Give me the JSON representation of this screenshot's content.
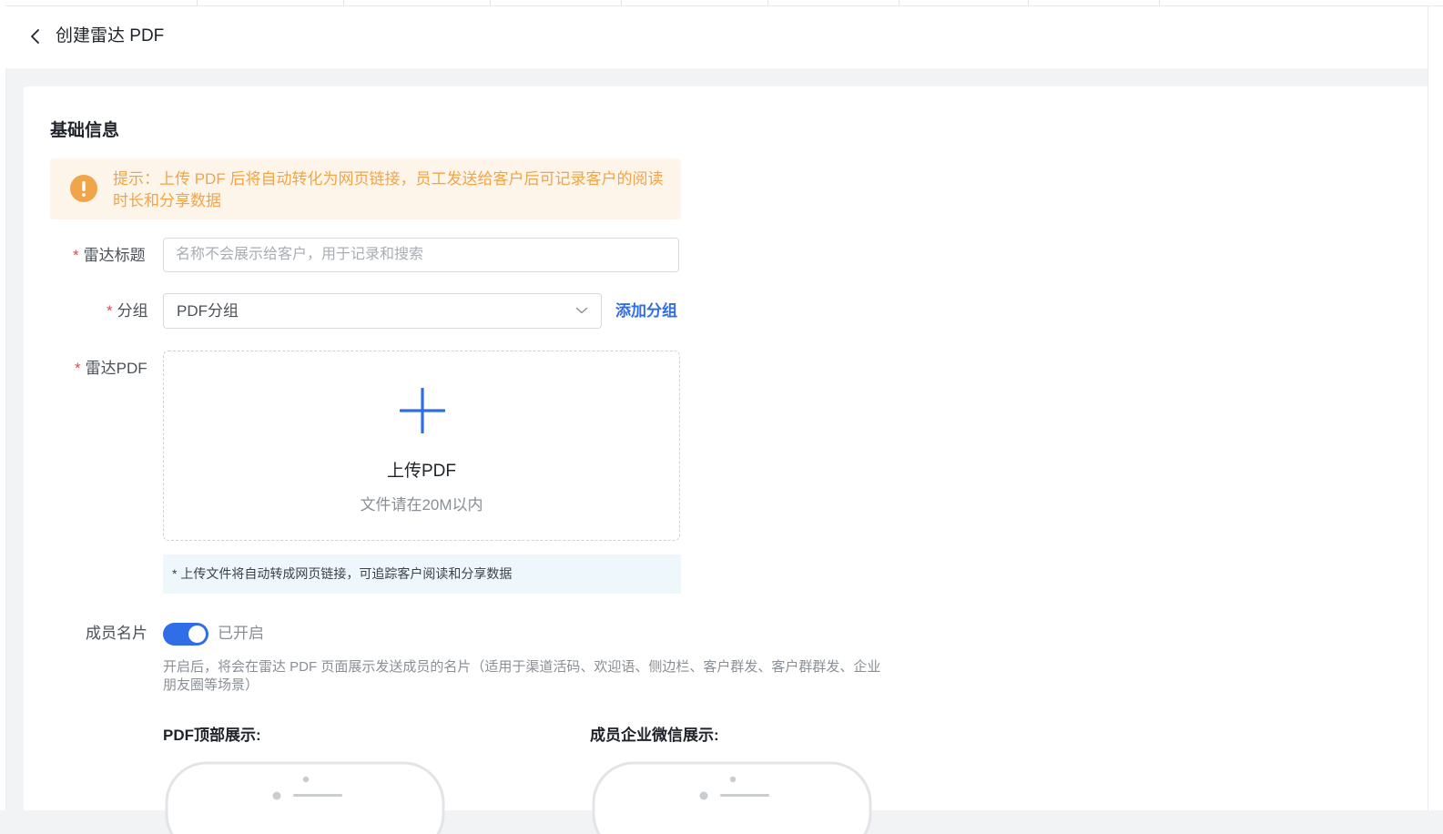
{
  "header": {
    "title": "创建雷达 PDF"
  },
  "section": {
    "title": "基础信息"
  },
  "alert": {
    "text": "提示：上传 PDF 后将自动转化为网页链接，员工发送给客户后可记录客户的阅读时长和分享数据"
  },
  "form": {
    "radar_title": {
      "required": "*",
      "label": "雷达标题",
      "placeholder": "名称不会展示给客户，用于记录和搜索",
      "value": ""
    },
    "group": {
      "required": "*",
      "label": "分组",
      "value": "PDF分组",
      "add_label": "添加分组"
    },
    "radar_pdf": {
      "required": "*",
      "label": "雷达PDF",
      "upload_label": "上传PDF",
      "upload_hint": "文件请在20M以内",
      "note": "* 上传文件将自动转成网页链接，可追踪客户阅读和分享数据"
    },
    "member_card": {
      "label": "成员名片",
      "enabled": true,
      "status": "已开启",
      "help": "开启后，将会在雷达 PDF 页面展示发送成员的名片（适用于渠道活码、欢迎语、侧边栏、客户群发、客户群群发、企业朋友圈等场景）"
    }
  },
  "preview": {
    "top_label": "PDF顶部展示:",
    "wechat_label": "成员企业微信展示:"
  },
  "colors": {
    "primary": "#2f6ee6",
    "warning": "#f0a54a",
    "required": "#e0484f"
  }
}
